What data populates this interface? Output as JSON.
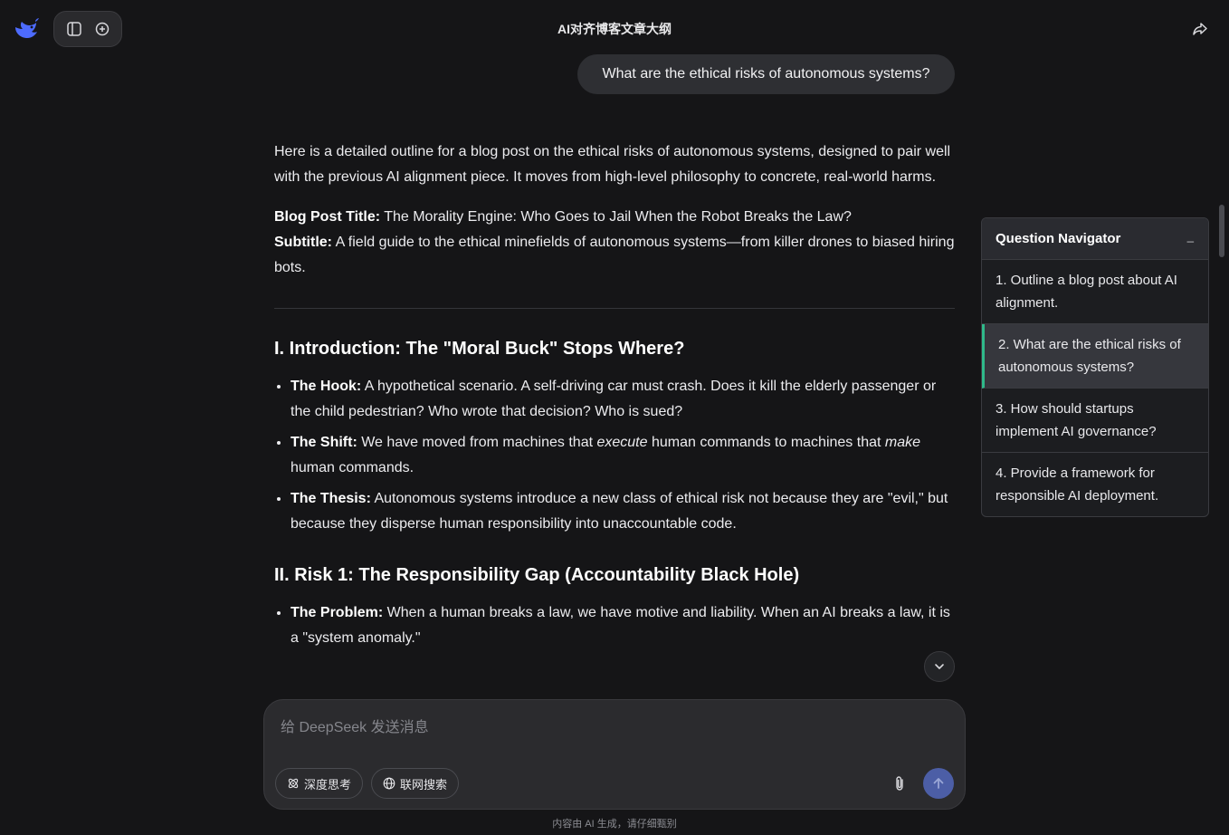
{
  "header": {
    "app_title": "AI对齐博客文章大纲",
    "logo_icon": "deepseek-whale-icon",
    "sidebar_toggle_icon": "sidebar-toggle-icon",
    "new_chat_icon": "new-chat-icon",
    "share_icon": "share-icon"
  },
  "conversation": {
    "user_question": "What are the ethical risks of autonomous systems?",
    "answer": {
      "intro": "Here is a detailed outline for a blog post on the ethical risks of autonomous systems, designed to pair well with the previous AI alignment piece. It moves from high-level philosophy to concrete, real-world harms.",
      "title_label": "Blog Post Title:",
      "title_value": " The Morality Engine: Who Goes to Jail When the Robot Breaks the Law?",
      "subtitle_label": "Subtitle:",
      "subtitle_value": " A field guide to the ethical minefields of autonomous systems—from killer drones to biased hiring bots.",
      "section1": {
        "heading": "I. Introduction: The \"Moral Buck\" Stops Where?",
        "hook_label": "The Hook:",
        "hook_text": " A hypothetical scenario. A self-driving car must crash. Does it kill the elderly passenger or the child pedestrian? Who wrote that decision? Who is sued?",
        "shift_label": "The Shift:",
        "shift_text_1": " We have moved from machines that ",
        "shift_em_1": "execute",
        "shift_text_2": " human commands to machines that ",
        "shift_em_2": "make",
        "shift_text_3": " human commands.",
        "thesis_label": "The Thesis:",
        "thesis_text": " Autonomous systems introduce a new class of ethical risk not because they are \"evil,\" but because they disperse human responsibility into unaccountable code."
      },
      "section2": {
        "heading": "II. Risk 1: The Responsibility Gap (Accountability Black Hole)",
        "problem_label": "The Problem:",
        "problem_text": " When a human breaks a law, we have motive and liability. When an AI breaks a law, it is a \"system anomaly.\""
      }
    },
    "scroll_down_icon": "chevron-down-icon"
  },
  "composer": {
    "placeholder": "给 DeepSeek 发送消息",
    "deep_think_label": "深度思考",
    "web_search_label": "联网搜索",
    "attach_icon": "paperclip-icon",
    "send_icon": "arrow-up-icon"
  },
  "disclaimer": "内容由 AI 生成，请仔细甄别",
  "navigator": {
    "title": "Question Navigator",
    "minimize_label": "_",
    "items": [
      {
        "label": "1. Outline a blog post about AI alignment.",
        "active": false
      },
      {
        "label": "2. What are the ethical risks of autonomous systems?",
        "active": true
      },
      {
        "label": "3. How should startups implement AI governance?",
        "active": false
      },
      {
        "label": "4. Provide a framework for responsible AI deployment.",
        "active": false
      }
    ]
  },
  "colors": {
    "background": "#151517",
    "accent_active": "#2fb98a",
    "send_button": "#4c5ea6",
    "logo": "#4d6bfe"
  }
}
